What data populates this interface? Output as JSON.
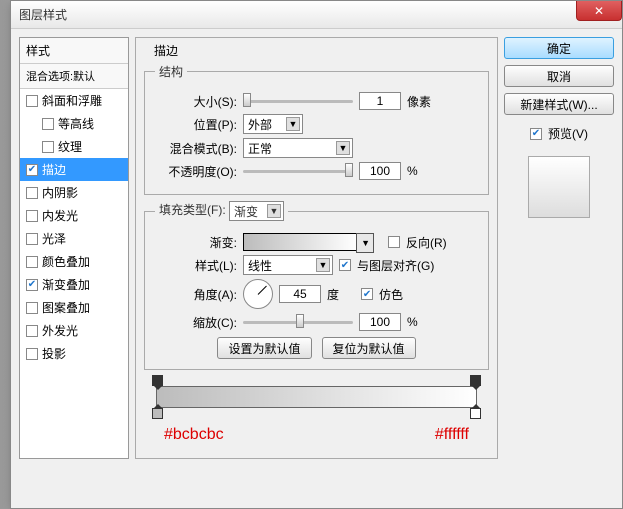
{
  "window": {
    "title": "图层样式",
    "close": "✕"
  },
  "styles_panel": {
    "header": "样式",
    "sub": "混合选项:默认",
    "items": [
      {
        "label": "斜面和浮雕",
        "checked": false,
        "indent": false
      },
      {
        "label": "等高线",
        "checked": false,
        "indent": true
      },
      {
        "label": "纹理",
        "checked": false,
        "indent": true
      },
      {
        "label": "描边",
        "checked": true,
        "indent": false,
        "selected": true
      },
      {
        "label": "内阴影",
        "checked": false,
        "indent": false
      },
      {
        "label": "内发光",
        "checked": false,
        "indent": false
      },
      {
        "label": "光泽",
        "checked": false,
        "indent": false
      },
      {
        "label": "颜色叠加",
        "checked": false,
        "indent": false
      },
      {
        "label": "渐变叠加",
        "checked": true,
        "indent": false
      },
      {
        "label": "图案叠加",
        "checked": false,
        "indent": false
      },
      {
        "label": "外发光",
        "checked": false,
        "indent": false
      },
      {
        "label": "投影",
        "checked": false,
        "indent": false
      }
    ]
  },
  "main": {
    "stroke_legend": "描边",
    "structure_legend": "结构",
    "size_label": "大小(S):",
    "size_value": "1",
    "size_unit": "像素",
    "position_label": "位置(P):",
    "position_value": "外部",
    "blend_label": "混合模式(B):",
    "blend_value": "正常",
    "opacity_label": "不透明度(O):",
    "opacity_value": "100",
    "opacity_unit": "%",
    "fill_type_label": "填充类型(F):",
    "fill_type_value": "渐变",
    "gradient_label": "渐变:",
    "reverse_label": "反向(R)",
    "reverse_checked": false,
    "style_label": "样式(L):",
    "style_value": "线性",
    "align_label": "与图层对齐(G)",
    "align_checked": true,
    "angle_label": "角度(A):",
    "angle_value": "45",
    "angle_unit": "度",
    "dither_label": "仿色",
    "dither_checked": true,
    "scale_label": "缩放(C):",
    "scale_value": "100",
    "scale_unit": "%",
    "set_default": "设置为默认值",
    "reset_default": "复位为默认值",
    "hex_left": "#bcbcbc",
    "hex_right": "#ffffff"
  },
  "right": {
    "ok": "确定",
    "cancel": "取消",
    "new_style": "新建样式(W)...",
    "preview_label": "预览(V)",
    "preview_checked": true
  },
  "chart_data": {
    "type": "gradient",
    "stops": [
      {
        "position": 0,
        "color": "#bcbcbc"
      },
      {
        "position": 100,
        "color": "#ffffff"
      }
    ]
  }
}
